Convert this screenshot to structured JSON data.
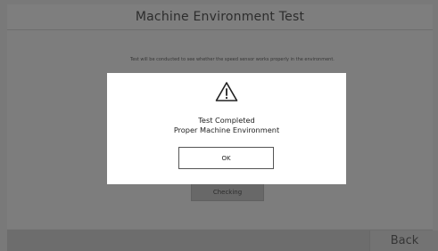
{
  "header": {
    "title": "Machine Environment Test"
  },
  "main": {
    "description": "Test will be conducted to see whether the speed sensor works properly in the environment.",
    "checking_label": "Checking"
  },
  "footer": {
    "back_label": "Back"
  },
  "dialog": {
    "icon": "warning-triangle-icon",
    "message_line1": "Test Completed",
    "message_line2": "Proper Machine Environment",
    "ok_label": "OK"
  }
}
